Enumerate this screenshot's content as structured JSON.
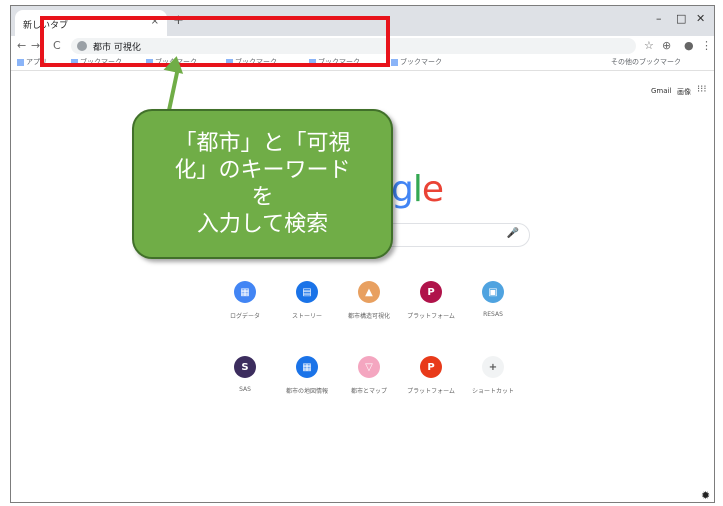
{
  "browser": {
    "tab_title": "新しいタブ",
    "tab_close": "×",
    "new_tab": "+",
    "win_min": "–",
    "win_max": "□",
    "win_close": "✕",
    "nav_back": "←",
    "nav_forward": "→",
    "nav_reload": "C",
    "url_value": "都市 可視化",
    "toolbar_star": "☆",
    "toolbar_ext": "⊕",
    "toolbar_profile": "●",
    "toolbar_menu": "⋮",
    "bookmarks": [
      "アプリ",
      "ブックマーク",
      "ブックマーク",
      "ブックマーク",
      "ブックマーク",
      "ブックマーク",
      "その他のブックマーク"
    ]
  },
  "newtab": {
    "gmail": "Gmail",
    "images": "画像",
    "apps_icon": "⁝⁝⁝",
    "logo": [
      "g",
      "l",
      "e"
    ],
    "mic": "🎤",
    "shortcuts_row1": [
      {
        "glyph": "▦",
        "label": "ログデータ",
        "color": "#4285f4"
      },
      {
        "glyph": "▤",
        "label": "ストーリー",
        "color": "#1a73e8"
      },
      {
        "glyph": "▲",
        "label": "都市構造可視化",
        "color": "#e8a060"
      },
      {
        "glyph": "P",
        "label": "プラットフォーム",
        "color": "#b0134a"
      },
      {
        "glyph": "▣",
        "label": "RESAS",
        "color": "#4fa3e0"
      }
    ],
    "shortcuts_row2": [
      {
        "glyph": "S",
        "label": "SAS",
        "color": "#3c2d5e"
      },
      {
        "glyph": "▦",
        "label": "都市の地図情報",
        "color": "#1a73e8"
      },
      {
        "glyph": "▽",
        "label": "都市とマップ",
        "color": "#f4a6c0"
      },
      {
        "glyph": "P",
        "label": "プラットフォーム",
        "color": "#e83a1a"
      },
      {
        "glyph": "+",
        "label": "ショートカット",
        "color": "#f1f3f4"
      }
    ],
    "settings_icon": "✹"
  },
  "annotation": {
    "callout_text": "「都市」と「可視\n化」のキーワード\nを\n入力して検索",
    "highlight_color": "#e8131b",
    "callout_color": "#70ad47"
  }
}
